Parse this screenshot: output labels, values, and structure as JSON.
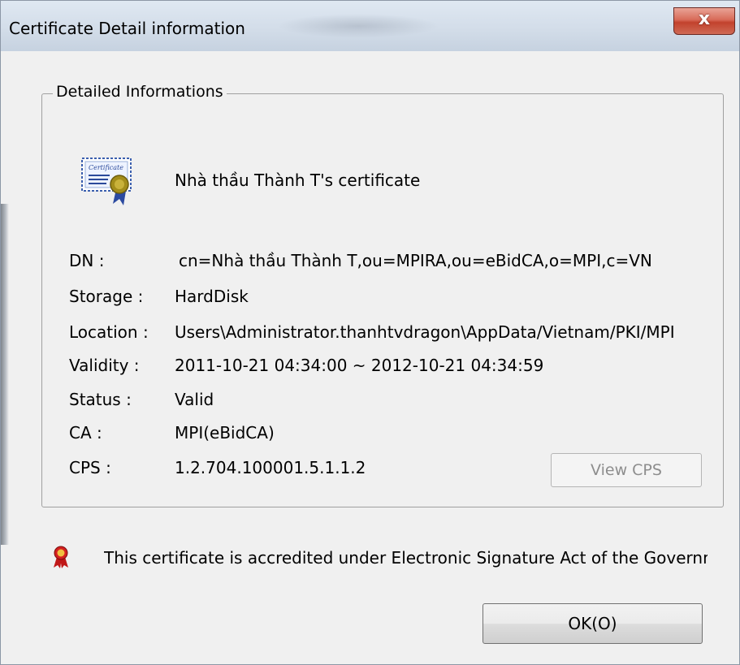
{
  "window": {
    "title": "Certificate Detail information",
    "close_glyph": "x"
  },
  "group": {
    "legend": "Detailed Informations"
  },
  "certificate": {
    "icon": "certificate-icon",
    "name": "Nhà thầu Thành T's certificate"
  },
  "fields": [
    {
      "label": "DN :",
      "value": "cn=Nhà thầu Thành T,ou=MPIRA,ou=eBidCA,o=MPI,c=VN"
    },
    {
      "label": "Storage :",
      "value": "HardDisk"
    },
    {
      "label": "Location :",
      "value": "Users\\Administrator.thanhtvdragon\\AppData/Vietnam/PKI/MPI"
    },
    {
      "label": "Validity :",
      "value": "2011-10-21 04:34:00 ~ 2012-10-21 04:34:59"
    },
    {
      "label": "Status :",
      "value": "Valid"
    },
    {
      "label": "CA :",
      "value": "MPI(eBidCA)"
    },
    {
      "label": "CPS :",
      "value": "1.2.704.100001.5.1.1.2"
    }
  ],
  "buttons": {
    "view_cps": "View CPS",
    "ok": "OK(O)"
  },
  "footer": {
    "icon": "award-ribbon-icon",
    "text": "This certificate is accredited under Electronic Signature Act of the Government"
  },
  "colors": {
    "close_button": "#c9503b",
    "window_bg": "#f0f0f0",
    "disabled_text": "#8d8d8d"
  }
}
